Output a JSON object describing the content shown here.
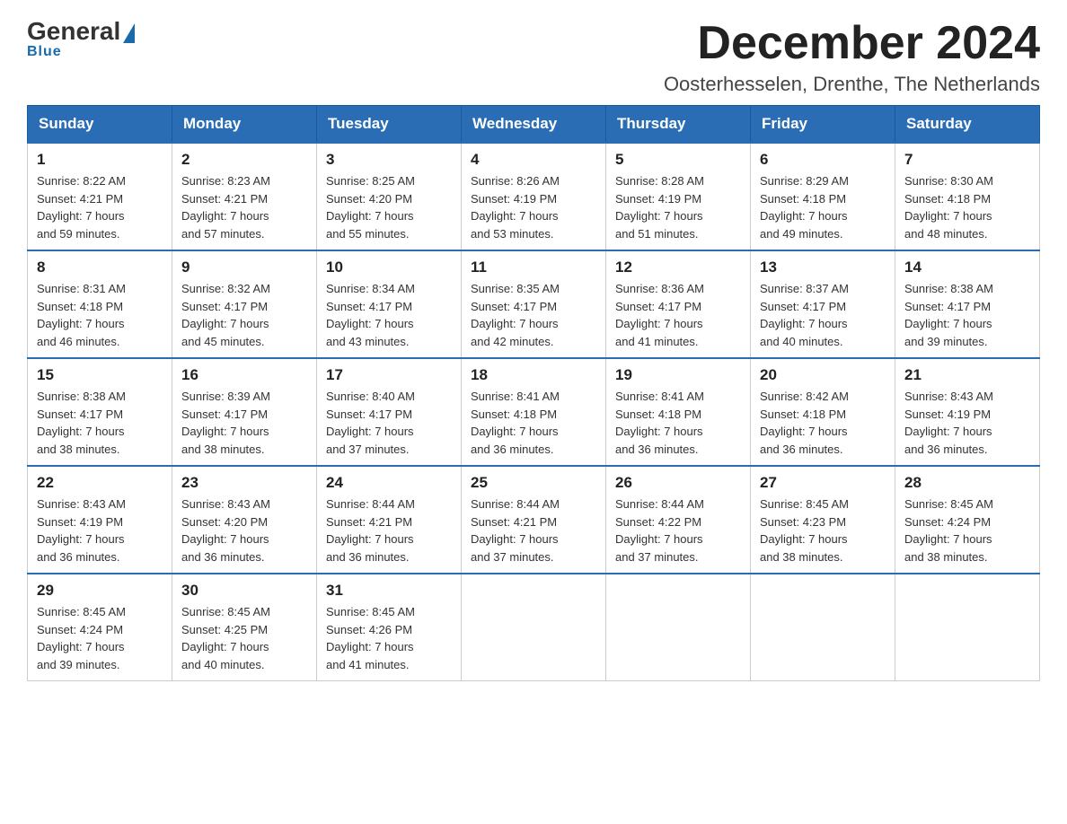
{
  "logo": {
    "name_part1": "General",
    "name_part2": "Blue"
  },
  "header": {
    "month_year": "December 2024",
    "location": "Oosterhesselen, Drenthe, The Netherlands"
  },
  "weekdays": [
    "Sunday",
    "Monday",
    "Tuesday",
    "Wednesday",
    "Thursday",
    "Friday",
    "Saturday"
  ],
  "weeks": [
    [
      {
        "day": "1",
        "sunrise": "8:22 AM",
        "sunset": "4:21 PM",
        "daylight": "7 hours and 59 minutes."
      },
      {
        "day": "2",
        "sunrise": "8:23 AM",
        "sunset": "4:21 PM",
        "daylight": "7 hours and 57 minutes."
      },
      {
        "day": "3",
        "sunrise": "8:25 AM",
        "sunset": "4:20 PM",
        "daylight": "7 hours and 55 minutes."
      },
      {
        "day": "4",
        "sunrise": "8:26 AM",
        "sunset": "4:19 PM",
        "daylight": "7 hours and 53 minutes."
      },
      {
        "day": "5",
        "sunrise": "8:28 AM",
        "sunset": "4:19 PM",
        "daylight": "7 hours and 51 minutes."
      },
      {
        "day": "6",
        "sunrise": "8:29 AM",
        "sunset": "4:18 PM",
        "daylight": "7 hours and 49 minutes."
      },
      {
        "day": "7",
        "sunrise": "8:30 AM",
        "sunset": "4:18 PM",
        "daylight": "7 hours and 48 minutes."
      }
    ],
    [
      {
        "day": "8",
        "sunrise": "8:31 AM",
        "sunset": "4:18 PM",
        "daylight": "7 hours and 46 minutes."
      },
      {
        "day": "9",
        "sunrise": "8:32 AM",
        "sunset": "4:17 PM",
        "daylight": "7 hours and 45 minutes."
      },
      {
        "day": "10",
        "sunrise": "8:34 AM",
        "sunset": "4:17 PM",
        "daylight": "7 hours and 43 minutes."
      },
      {
        "day": "11",
        "sunrise": "8:35 AM",
        "sunset": "4:17 PM",
        "daylight": "7 hours and 42 minutes."
      },
      {
        "day": "12",
        "sunrise": "8:36 AM",
        "sunset": "4:17 PM",
        "daylight": "7 hours and 41 minutes."
      },
      {
        "day": "13",
        "sunrise": "8:37 AM",
        "sunset": "4:17 PM",
        "daylight": "7 hours and 40 minutes."
      },
      {
        "day": "14",
        "sunrise": "8:38 AM",
        "sunset": "4:17 PM",
        "daylight": "7 hours and 39 minutes."
      }
    ],
    [
      {
        "day": "15",
        "sunrise": "8:38 AM",
        "sunset": "4:17 PM",
        "daylight": "7 hours and 38 minutes."
      },
      {
        "day": "16",
        "sunrise": "8:39 AM",
        "sunset": "4:17 PM",
        "daylight": "7 hours and 38 minutes."
      },
      {
        "day": "17",
        "sunrise": "8:40 AM",
        "sunset": "4:17 PM",
        "daylight": "7 hours and 37 minutes."
      },
      {
        "day": "18",
        "sunrise": "8:41 AM",
        "sunset": "4:18 PM",
        "daylight": "7 hours and 36 minutes."
      },
      {
        "day": "19",
        "sunrise": "8:41 AM",
        "sunset": "4:18 PM",
        "daylight": "7 hours and 36 minutes."
      },
      {
        "day": "20",
        "sunrise": "8:42 AM",
        "sunset": "4:18 PM",
        "daylight": "7 hours and 36 minutes."
      },
      {
        "day": "21",
        "sunrise": "8:43 AM",
        "sunset": "4:19 PM",
        "daylight": "7 hours and 36 minutes."
      }
    ],
    [
      {
        "day": "22",
        "sunrise": "8:43 AM",
        "sunset": "4:19 PM",
        "daylight": "7 hours and 36 minutes."
      },
      {
        "day": "23",
        "sunrise": "8:43 AM",
        "sunset": "4:20 PM",
        "daylight": "7 hours and 36 minutes."
      },
      {
        "day": "24",
        "sunrise": "8:44 AM",
        "sunset": "4:21 PM",
        "daylight": "7 hours and 36 minutes."
      },
      {
        "day": "25",
        "sunrise": "8:44 AM",
        "sunset": "4:21 PM",
        "daylight": "7 hours and 37 minutes."
      },
      {
        "day": "26",
        "sunrise": "8:44 AM",
        "sunset": "4:22 PM",
        "daylight": "7 hours and 37 minutes."
      },
      {
        "day": "27",
        "sunrise": "8:45 AM",
        "sunset": "4:23 PM",
        "daylight": "7 hours and 38 minutes."
      },
      {
        "day": "28",
        "sunrise": "8:45 AM",
        "sunset": "4:24 PM",
        "daylight": "7 hours and 38 minutes."
      }
    ],
    [
      {
        "day": "29",
        "sunrise": "8:45 AM",
        "sunset": "4:24 PM",
        "daylight": "7 hours and 39 minutes."
      },
      {
        "day": "30",
        "sunrise": "8:45 AM",
        "sunset": "4:25 PM",
        "daylight": "7 hours and 40 minutes."
      },
      {
        "day": "31",
        "sunrise": "8:45 AM",
        "sunset": "4:26 PM",
        "daylight": "7 hours and 41 minutes."
      },
      null,
      null,
      null,
      null
    ]
  ],
  "labels": {
    "sunrise": "Sunrise:",
    "sunset": "Sunset:",
    "daylight": "Daylight:"
  }
}
